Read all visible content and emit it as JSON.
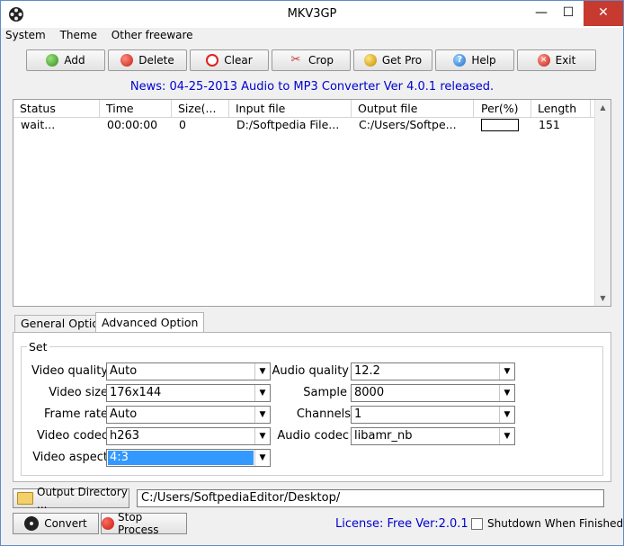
{
  "window": {
    "title": "MKV3GP"
  },
  "menu": [
    "System",
    "Theme",
    "Other freeware"
  ],
  "toolbar": {
    "add": "Add",
    "delete": "Delete",
    "clear": "Clear",
    "crop": "Crop",
    "get_pro": "Get Pro",
    "help": "Help",
    "exit": "Exit"
  },
  "news": "News: 04-25-2013 Audio to MP3 Converter Ver 4.0.1 released.",
  "list": {
    "columns": [
      "Status",
      "Time",
      "Size(...",
      "Input file",
      "Output file",
      "Per(%)",
      "Length"
    ],
    "rows": [
      {
        "status": "wait...",
        "time": "00:00:00",
        "size": "0",
        "input": "D:/Softpedia File...",
        "output": "C:/Users/Softpe...",
        "progress": 0,
        "length": "151"
      }
    ]
  },
  "tabs": {
    "general": "General Option",
    "advanced": "Advanced Option"
  },
  "group": {
    "title": "Set"
  },
  "fields": {
    "video_quality": {
      "label": "Video quality",
      "value": "Auto"
    },
    "video_size": {
      "label": "Video size",
      "value": "176x144"
    },
    "frame_rate": {
      "label": "Frame rate",
      "value": "Auto"
    },
    "video_codec": {
      "label": "Video codec",
      "value": "h263"
    },
    "video_aspect": {
      "label": "Video aspect",
      "value": "4:3"
    },
    "audio_quality": {
      "label": "Audio quality",
      "value": "12.2"
    },
    "sample": {
      "label": "Sample",
      "value": "8000"
    },
    "channels": {
      "label": "Channels",
      "value": "1"
    },
    "audio_codec": {
      "label": "Audio codec",
      "value": "libamr_nb"
    }
  },
  "output": {
    "button": "Output Directory ...",
    "path": "C:/Users/SoftpediaEditor/Desktop/"
  },
  "actions": {
    "convert": "Convert",
    "stop": "Stop Process"
  },
  "license": "License: Free Ver:2.0.1",
  "shutdown": "Shutdown When Finished"
}
